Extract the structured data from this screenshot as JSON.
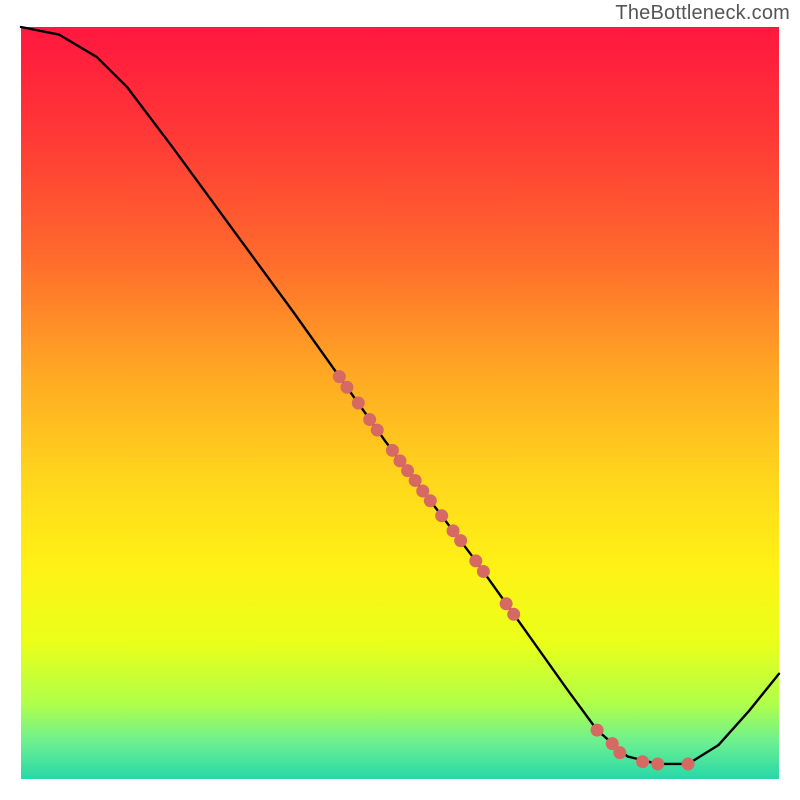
{
  "attribution": "TheBottleneck.com",
  "chart_data": {
    "type": "line",
    "title": "",
    "xlabel": "",
    "ylabel": "",
    "xlim": [
      0,
      100
    ],
    "ylim": [
      0,
      100
    ],
    "grid": false,
    "legend": false,
    "background": {
      "description": "vertical gradient from red (high y) through orange/yellow to green (low y)",
      "stops": [
        {
          "offset": 0.0,
          "color": "#ff173f"
        },
        {
          "offset": 0.15,
          "color": "#ff3a36"
        },
        {
          "offset": 0.3,
          "color": "#ff682d"
        },
        {
          "offset": 0.45,
          "color": "#ffa424"
        },
        {
          "offset": 0.6,
          "color": "#ffd61c"
        },
        {
          "offset": 0.72,
          "color": "#fff215"
        },
        {
          "offset": 0.82,
          "color": "#e9ff1a"
        },
        {
          "offset": 0.9,
          "color": "#b0ff4a"
        },
        {
          "offset": 0.95,
          "color": "#6df090"
        },
        {
          "offset": 1.0,
          "color": "#27d8a8"
        }
      ]
    },
    "curve": {
      "description": "bottleneck-style curve: starts near 100% at left, descends steeply, reaches minimum near x≈80–88, rises again",
      "points": [
        {
          "x": 0,
          "y": 100
        },
        {
          "x": 5,
          "y": 99
        },
        {
          "x": 10,
          "y": 96
        },
        {
          "x": 14,
          "y": 92
        },
        {
          "x": 20,
          "y": 84
        },
        {
          "x": 28,
          "y": 73
        },
        {
          "x": 36,
          "y": 62
        },
        {
          "x": 42,
          "y": 53.5
        },
        {
          "x": 48,
          "y": 45
        },
        {
          "x": 54,
          "y": 37
        },
        {
          "x": 60,
          "y": 29
        },
        {
          "x": 66,
          "y": 20.5
        },
        {
          "x": 72,
          "y": 12
        },
        {
          "x": 76,
          "y": 6.5
        },
        {
          "x": 80,
          "y": 3
        },
        {
          "x": 84,
          "y": 2
        },
        {
          "x": 88,
          "y": 2
        },
        {
          "x": 92,
          "y": 4.5
        },
        {
          "x": 96,
          "y": 9
        },
        {
          "x": 100,
          "y": 14
        }
      ]
    },
    "series": [
      {
        "name": "highlighted-points",
        "marker_color": "#d66a63",
        "marker_radius": 6.5,
        "points": [
          {
            "x": 42,
            "y": 53.5
          },
          {
            "x": 43,
            "y": 52.1
          },
          {
            "x": 44.5,
            "y": 50
          },
          {
            "x": 46,
            "y": 47.8
          },
          {
            "x": 47,
            "y": 46.4
          },
          {
            "x": 49,
            "y": 43.7
          },
          {
            "x": 50,
            "y": 42.3
          },
          {
            "x": 51,
            "y": 41
          },
          {
            "x": 52,
            "y": 39.7
          },
          {
            "x": 53,
            "y": 38.3
          },
          {
            "x": 54,
            "y": 37
          },
          {
            "x": 55.5,
            "y": 35
          },
          {
            "x": 57,
            "y": 33
          },
          {
            "x": 58,
            "y": 31.7
          },
          {
            "x": 60,
            "y": 29
          },
          {
            "x": 61,
            "y": 27.6
          },
          {
            "x": 64,
            "y": 23.3
          },
          {
            "x": 65,
            "y": 21.9
          },
          {
            "x": 76,
            "y": 6.5
          },
          {
            "x": 78,
            "y": 4.7
          },
          {
            "x": 79,
            "y": 3.5
          },
          {
            "x": 82,
            "y": 2.3
          },
          {
            "x": 84,
            "y": 2
          },
          {
            "x": 88,
            "y": 2
          }
        ]
      }
    ]
  }
}
